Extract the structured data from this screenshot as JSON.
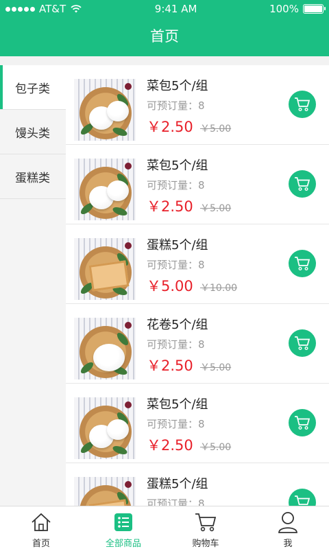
{
  "status": {
    "carrier": "AT&T",
    "time": "9:41 AM",
    "battery": "100%"
  },
  "header": {
    "title": "首页"
  },
  "categories": [
    {
      "label": "包子类",
      "active": true
    },
    {
      "label": "馒头类",
      "active": false
    },
    {
      "label": "蛋糕类",
      "active": false
    }
  ],
  "products": [
    {
      "name": "菜包5个/组",
      "qty_label": "可预订量：8",
      "price": "￥2.50",
      "old_price": "￥5.00",
      "image": "buns"
    },
    {
      "name": "菜包5个/组",
      "qty_label": "可预订量：8",
      "price": "￥2.50",
      "old_price": "￥5.00",
      "image": "buns"
    },
    {
      "name": "蛋糕5个/组",
      "qty_label": "可预订量：8",
      "price": "￥5.00",
      "old_price": "￥10.00",
      "image": "cake"
    },
    {
      "name": "花卷5个/组",
      "qty_label": "可预订量：8",
      "price": "￥2.50",
      "old_price": "￥5.00",
      "image": "roll"
    },
    {
      "name": "菜包5个/组",
      "qty_label": "可预订量：8",
      "price": "￥2.50",
      "old_price": "￥5.00",
      "image": "buns"
    },
    {
      "name": "蛋糕5个/组",
      "qty_label": "可预订量：8",
      "price": "",
      "old_price": "",
      "image": "cake"
    }
  ],
  "tabs": [
    {
      "label": "首页",
      "icon": "home-icon",
      "active": false
    },
    {
      "label": "全部商品",
      "icon": "list-icon",
      "active": true
    },
    {
      "label": "购物车",
      "icon": "cart-icon",
      "active": false
    },
    {
      "label": "我",
      "icon": "user-icon",
      "active": false
    }
  ],
  "colors": {
    "accent": "#1bbf83",
    "price": "#e8202a"
  }
}
